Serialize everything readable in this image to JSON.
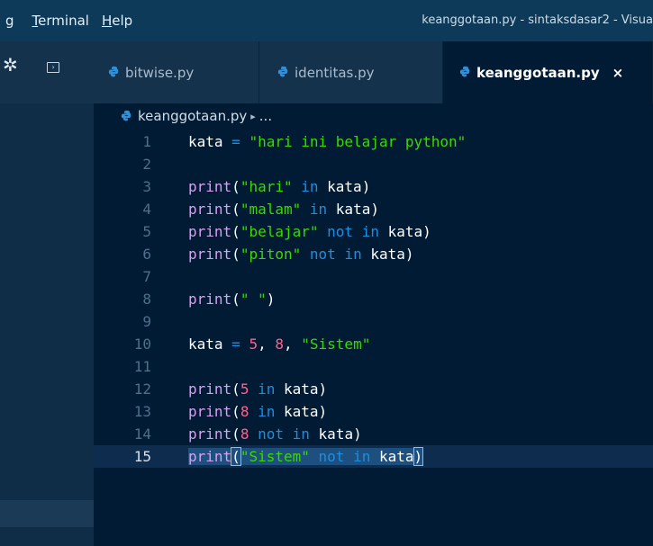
{
  "menu": {
    "items": [
      {
        "pre": "",
        "u": "",
        "post": "g"
      },
      {
        "pre": "",
        "u": "T",
        "post": "erminal"
      },
      {
        "pre": "",
        "u": "H",
        "post": "elp"
      }
    ]
  },
  "window_title": "keanggotaan.py - sintaksdasar2 - Visua",
  "tabs": [
    {
      "label": "bitwise.py",
      "active": false
    },
    {
      "label": "identitas.py",
      "active": false
    },
    {
      "label": "keanggotaan.py",
      "active": true,
      "close": "×"
    }
  ],
  "breadcrumb": {
    "file": "keanggotaan.py",
    "sep": "▸",
    "rest": "..."
  },
  "colors": {
    "python_icon": "#2f8fd8",
    "accent": "#0e2c4e"
  },
  "editor": {
    "current_line": 15,
    "lines": [
      {
        "n": "1",
        "tokens": [
          [
            "id",
            "kata"
          ],
          [
            "pn",
            " "
          ],
          [
            "op",
            "="
          ],
          [
            "pn",
            " "
          ],
          [
            "str",
            "\"hari ini belajar python\""
          ]
        ]
      },
      {
        "n": "2",
        "tokens": []
      },
      {
        "n": "3",
        "tokens": [
          [
            "kw",
            "print"
          ],
          [
            "pn",
            "("
          ],
          [
            "str",
            "\"hari\""
          ],
          [
            "pn",
            " "
          ],
          [
            "op",
            "in"
          ],
          [
            "pn",
            " "
          ],
          [
            "id",
            "kata"
          ],
          [
            "pn",
            ")"
          ]
        ]
      },
      {
        "n": "4",
        "tokens": [
          [
            "kw",
            "print"
          ],
          [
            "pn",
            "("
          ],
          [
            "str",
            "\"malam\""
          ],
          [
            "pn",
            " "
          ],
          [
            "op",
            "in"
          ],
          [
            "pn",
            " "
          ],
          [
            "id",
            "kata"
          ],
          [
            "pn",
            ")"
          ]
        ]
      },
      {
        "n": "5",
        "tokens": [
          [
            "kw",
            "print"
          ],
          [
            "pn",
            "("
          ],
          [
            "str",
            "\"belajar\""
          ],
          [
            "pn",
            " "
          ],
          [
            "op",
            "not"
          ],
          [
            "pn",
            " "
          ],
          [
            "op",
            "in"
          ],
          [
            "pn",
            " "
          ],
          [
            "id",
            "kata"
          ],
          [
            "pn",
            ")"
          ]
        ]
      },
      {
        "n": "6",
        "tokens": [
          [
            "kw",
            "print"
          ],
          [
            "pn",
            "("
          ],
          [
            "str",
            "\"piton\""
          ],
          [
            "pn",
            " "
          ],
          [
            "op",
            "not"
          ],
          [
            "pn",
            " "
          ],
          [
            "op",
            "in"
          ],
          [
            "pn",
            " "
          ],
          [
            "id",
            "kata"
          ],
          [
            "pn",
            ")"
          ]
        ]
      },
      {
        "n": "7",
        "tokens": []
      },
      {
        "n": "8",
        "tokens": [
          [
            "kw",
            "print"
          ],
          [
            "pn",
            "("
          ],
          [
            "str",
            "\" \""
          ],
          [
            "pn",
            ")"
          ]
        ]
      },
      {
        "n": "9",
        "tokens": []
      },
      {
        "n": "10",
        "tokens": [
          [
            "id",
            "kata"
          ],
          [
            "pn",
            " "
          ],
          [
            "op",
            "="
          ],
          [
            "pn",
            " "
          ],
          [
            "num",
            "5"
          ],
          [
            "pn",
            ", "
          ],
          [
            "num",
            "8"
          ],
          [
            "pn",
            ", "
          ],
          [
            "str",
            "\"Sistem\""
          ]
        ]
      },
      {
        "n": "11",
        "tokens": []
      },
      {
        "n": "12",
        "tokens": [
          [
            "kw",
            "print"
          ],
          [
            "pn",
            "("
          ],
          [
            "num",
            "5"
          ],
          [
            "pn",
            " "
          ],
          [
            "op",
            "in"
          ],
          [
            "pn",
            " "
          ],
          [
            "id",
            "kata"
          ],
          [
            "pn",
            ")"
          ]
        ]
      },
      {
        "n": "13",
        "tokens": [
          [
            "kw",
            "print"
          ],
          [
            "pn",
            "("
          ],
          [
            "num",
            "8"
          ],
          [
            "pn",
            " "
          ],
          [
            "op",
            "in"
          ],
          [
            "pn",
            " "
          ],
          [
            "id",
            "kata"
          ],
          [
            "pn",
            ")"
          ]
        ]
      },
      {
        "n": "14",
        "tokens": [
          [
            "kw",
            "print"
          ],
          [
            "pn",
            "("
          ],
          [
            "num",
            "8"
          ],
          [
            "pn",
            " "
          ],
          [
            "op",
            "not"
          ],
          [
            "pn",
            " "
          ],
          [
            "op",
            "in"
          ],
          [
            "pn",
            " "
          ],
          [
            "id",
            "kata"
          ],
          [
            "pn",
            ")"
          ]
        ]
      },
      {
        "n": "15",
        "tokens": [
          [
            "kw",
            "print"
          ],
          [
            "pn",
            "("
          ],
          [
            "str",
            "\"Sistem\""
          ],
          [
            "pn",
            " "
          ],
          [
            "op",
            "not"
          ],
          [
            "pn",
            " "
          ],
          [
            "op",
            "in"
          ],
          [
            "pn",
            " "
          ],
          [
            "id",
            "kata"
          ],
          [
            "pn",
            ")"
          ]
        ]
      }
    ]
  }
}
